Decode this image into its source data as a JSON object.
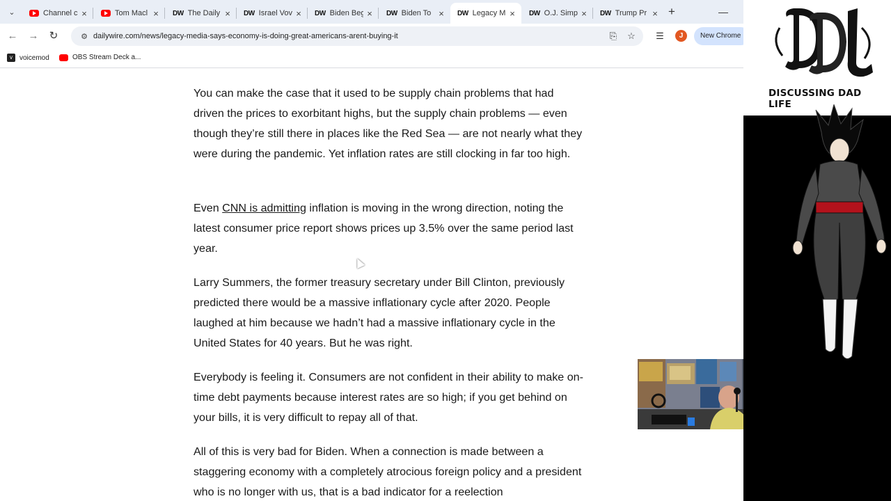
{
  "browser": {
    "tabs": [
      {
        "label": "Channel c",
        "icon": "youtube-icon",
        "active": false
      },
      {
        "label": "Tom Macl",
        "icon": "youtube-icon",
        "active": false
      },
      {
        "label": "The Daily",
        "icon": "dailywire-icon",
        "active": false
      },
      {
        "label": "Israel Vov",
        "icon": "dailywire-icon",
        "active": false
      },
      {
        "label": "Biden Beg",
        "icon": "dailywire-icon",
        "active": false
      },
      {
        "label": "Biden To",
        "icon": "dailywire-icon",
        "active": false
      },
      {
        "label": "Legacy M",
        "icon": "dailywire-icon",
        "active": true
      },
      {
        "label": "O.J. Simp",
        "icon": "dailywire-icon",
        "active": false
      },
      {
        "label": "Trump Pr",
        "icon": "dailywire-icon",
        "active": false
      }
    ],
    "favicon_text": "DW",
    "url": "dailywire.com/news/legacy-media-says-economy-is-doing-great-americans-arent-buying-it",
    "new_chrome_label": "New Chrome",
    "profile_initial": "J",
    "bookmarks": [
      {
        "label": "voicemod",
        "icon": "voicemod-icon"
      },
      {
        "label": "OBS Stream Deck a...",
        "icon": "youtube-icon"
      }
    ]
  },
  "article": {
    "p1": "You can make the case that it used to be supply chain problems that had driven the prices to exorbitant highs, but the supply chain problems — even though they’re still there in places like the Red Sea — are not nearly what they were during the pandemic. Yet inflation rates are still clocking in far too high.",
    "p2_prefix": "Even ",
    "p2_link": "CNN is admitting",
    "p2_suffix": " inflation is moving in the wrong direction, noting the latest consumer price report shows prices up 3.5% over the same period last year.",
    "p3": "Larry Summers, the former treasury secretary under Bill Clinton, previously predicted there would be a massive inflationary cycle after 2020. People laughed at him because we hadn’t had a massive inflationary cycle in the United States for 40 years. But he was right.",
    "p4": "Everybody is feeling it. Consumers are not confident in their ability to make on-time debt payments because interest rates are so high; if you get behind on your bills, it is very difficult to repay all of that.",
    "p5": "All of this is very bad for Biden. When a connection is made between a staggering economy with a completely atrocious foreign policy and a president who is no longer with us, that is a bad indicator for a reelection"
  },
  "overlay": {
    "logo_text": "DISCUSSING DAD LIFE"
  }
}
